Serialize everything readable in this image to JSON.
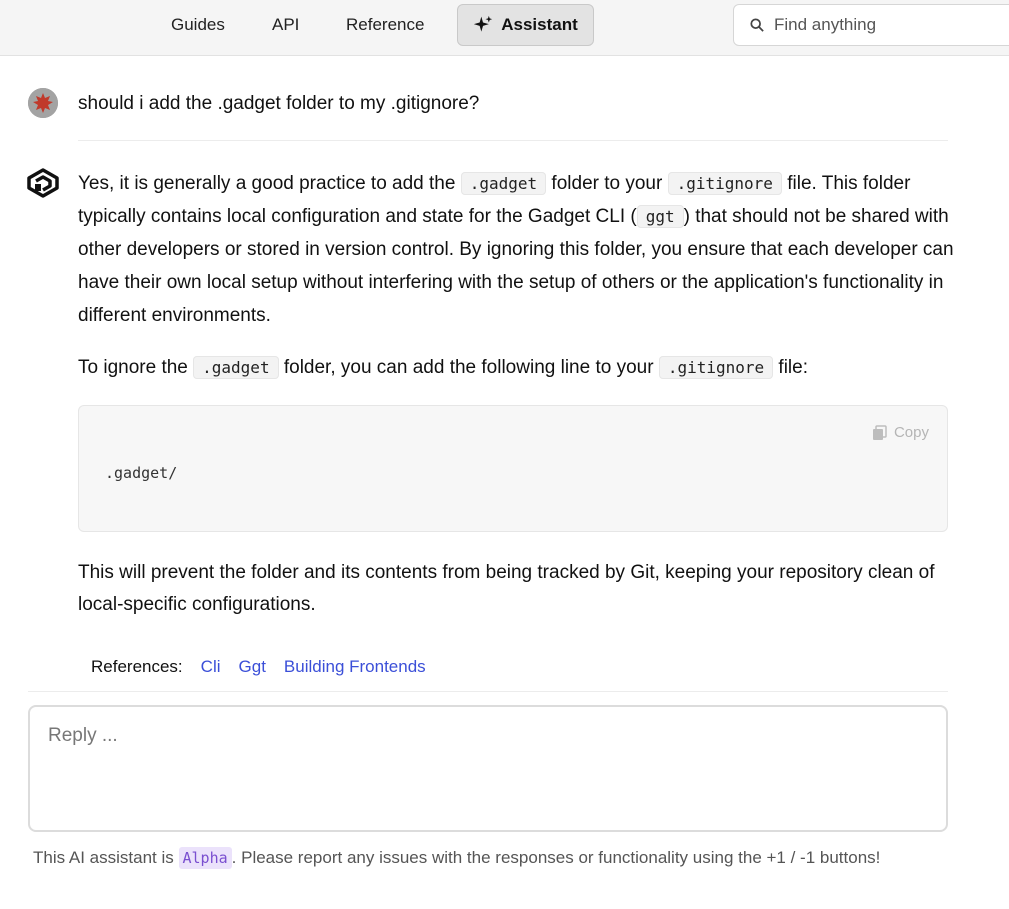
{
  "nav": {
    "guides": "Guides",
    "api": "API",
    "reference": "Reference",
    "assistant": "Assistant",
    "search_placeholder": "Find anything"
  },
  "conversation": {
    "user_message": "should i add the .gadget folder to my .gitignore?",
    "answer": {
      "p1": {
        "t1": "Yes, it is generally a good practice to add the ",
        "c1": ".gadget",
        "t2": " folder to your ",
        "c2": ".gitignore",
        "t3": " file. This folder typically contains local configuration and state for the Gadget CLI (",
        "c3": "ggt",
        "t4": ") that should not be shared with other developers or stored in version control. By ignoring this folder, you ensure that each developer can have their own local setup without interfering with the setup of others or the application's functionality in different environments."
      },
      "p2": {
        "t1": "To ignore the ",
        "c1": ".gadget",
        "t2": " folder, you can add the following line to your ",
        "c2": ".gitignore",
        "t3": " file:"
      },
      "code": ".gadget/",
      "copy_label": "Copy",
      "p3": "This will prevent the folder and its contents from being tracked by Git, keeping your repository clean of local-specific configurations."
    },
    "references": {
      "label": "References:",
      "links": [
        "Cli",
        "Ggt",
        "Building Frontends"
      ]
    }
  },
  "reply": {
    "placeholder": "Reply ..."
  },
  "footer": {
    "t1": "This AI assistant is ",
    "badge": "Alpha",
    "t2": ". Please report any issues with the responses or functionality using the +1 / -1 buttons!"
  },
  "colors": {
    "link": "#3b4fd8",
    "alpha_bg": "#ebe2fb",
    "alpha_text": "#7a4fd0",
    "topbar_bg": "#f5f5f5"
  }
}
